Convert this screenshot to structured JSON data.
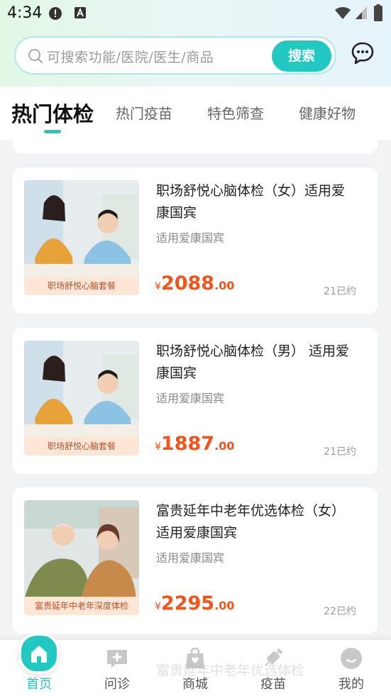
{
  "status_bar": {
    "time": "4:34"
  },
  "search": {
    "placeholder": "可搜索功能/医院/医生/商品",
    "button": "搜索"
  },
  "tabs": [
    {
      "label": "热门体检",
      "active": true
    },
    {
      "label": "热门疫苗",
      "active": false
    },
    {
      "label": "特色筛查",
      "active": false
    },
    {
      "label": "健康好物",
      "active": false
    }
  ],
  "products": [
    {
      "title": "职场舒悦心脑体检（女）适用爱康国宾",
      "subtitle": "适用爱康国宾",
      "currency": "¥",
      "price_int": "2088",
      "price_dec": ".00",
      "booked": "21已约",
      "image_caption": "职场舒悦心脑套餐"
    },
    {
      "title": "职场舒悦心脑体检（男） 适用爱康国宾",
      "subtitle": "适用爱康国宾",
      "currency": "¥",
      "price_int": "1887",
      "price_dec": ".00",
      "booked": "21已约",
      "image_caption": "职场舒悦心脑套餐"
    },
    {
      "title": "富贵延年中老年优选体检（女）适用爱康国宾",
      "subtitle": "适用爱康国宾",
      "currency": "¥",
      "price_int": "2295",
      "price_dec": ".00",
      "booked": "22已约",
      "image_caption": "富贵延年中老年深度体检"
    }
  ],
  "partial_next_item": "富贵延年中老年优选体检",
  "bottom_nav": [
    {
      "label": "首页",
      "icon": "home-icon",
      "active": true
    },
    {
      "label": "问诊",
      "icon": "consult-icon",
      "active": false
    },
    {
      "label": "商城",
      "icon": "shop-bag-icon",
      "active": false
    },
    {
      "label": "疫苗",
      "icon": "syringe-icon",
      "active": false
    },
    {
      "label": "我的",
      "icon": "profile-icon",
      "active": false
    }
  ],
  "colors": {
    "accent": "#22c9c3",
    "price": "#f2541b"
  }
}
